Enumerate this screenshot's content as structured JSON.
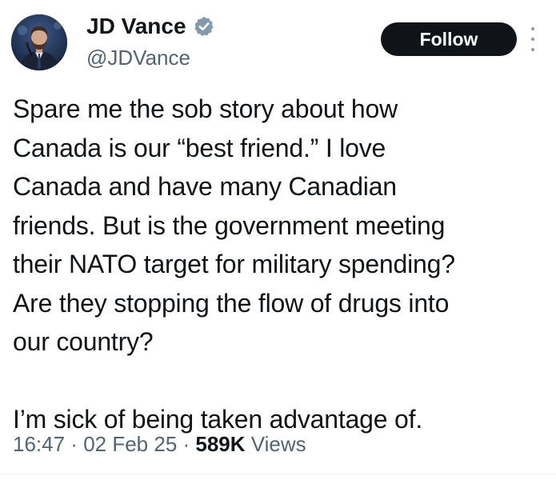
{
  "author": {
    "display_name": "JD Vance",
    "handle": "@JDVance",
    "verified": true
  },
  "follow_label": "Follow",
  "tweet": {
    "paragraph_1_lines": [
      "Spare me the sob story about how",
      "Canada is our “best friend.” I love",
      "Canada and have many Canadian",
      "friends. But is the government meeting",
      "their NATO target for military spending?",
      "Are they stopping the flow of drugs into",
      "our country?"
    ],
    "paragraph_2": "I’m sick of being taken advantage of."
  },
  "meta": {
    "time": "16:47",
    "separator_1": " · ",
    "date": "02 Feb 25",
    "separator_2": " · ",
    "views_count": "589K",
    "views_label": " Views"
  },
  "colors": {
    "text_primary": "#0f1419",
    "text_secondary": "#536471",
    "verified_badge": "#829aab",
    "follow_bg": "#0f1419"
  },
  "icons": {
    "verified": "verified-badge-icon",
    "more": "more-options-icon"
  }
}
